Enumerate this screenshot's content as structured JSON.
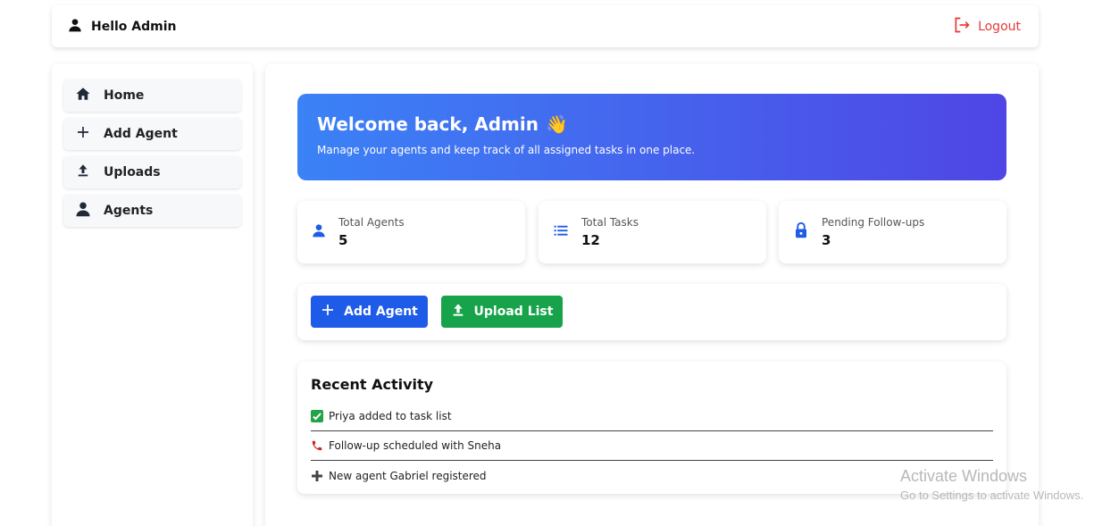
{
  "header": {
    "greeting": "Hello Admin",
    "logout_label": "Logout"
  },
  "sidebar": {
    "items": [
      {
        "label": "Home",
        "icon": "home-icon"
      },
      {
        "label": "Add Agent",
        "icon": "plus-icon"
      },
      {
        "label": "Uploads",
        "icon": "upload-icon"
      },
      {
        "label": "Agents",
        "icon": "user-icon"
      }
    ]
  },
  "hero": {
    "title": "Welcome back, Admin",
    "emoji": "👋",
    "subtitle": "Manage your agents and keep track of all assigned tasks in one place."
  },
  "stats": [
    {
      "label": "Total Agents",
      "value": "5",
      "icon": "user-icon"
    },
    {
      "label": "Total Tasks",
      "value": "12",
      "icon": "list-icon"
    },
    {
      "label": "Pending Follow-ups",
      "value": "3",
      "icon": "lock-icon"
    }
  ],
  "actions": {
    "add_agent_label": "Add Agent",
    "upload_list_label": "Upload List"
  },
  "activity": {
    "title": "Recent Activity",
    "items": [
      {
        "icon": "check-icon",
        "text": "Priya added to task list"
      },
      {
        "icon": "phone-icon",
        "text": "Follow-up scheduled with Sneha"
      },
      {
        "icon": "plus-icon",
        "text": "New agent Gabriel registered"
      }
    ]
  },
  "colors": {
    "primary_blue": "#1d5be8",
    "success_green": "#16a34a",
    "logout_red": "#e53935",
    "hero_gradient_start": "#3b82f6",
    "hero_gradient_end": "#4f46e5"
  },
  "watermark": {
    "line1": "Activate Windows",
    "line2": "Go to Settings to activate Windows."
  }
}
